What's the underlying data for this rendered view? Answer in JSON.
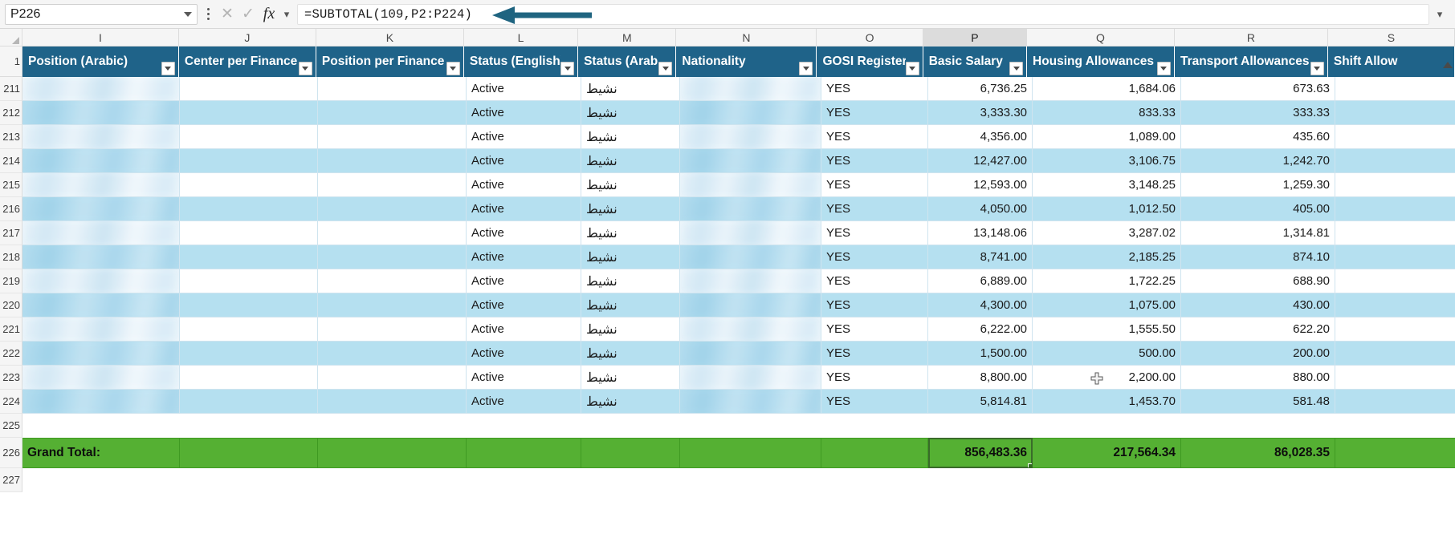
{
  "formula_bar": {
    "name_box_value": "P226",
    "formula": "=SUBTOTAL(109,P2:P224)",
    "cancel_icon": "close-icon",
    "confirm_icon": "check-icon",
    "fx_icon": "fx-icon",
    "arrow_color": "#1f6480"
  },
  "grid": {
    "column_letters": [
      "I",
      "J",
      "K",
      "L",
      "M",
      "N",
      "O",
      "P",
      "Q",
      "R",
      "S"
    ],
    "selected_column": "P",
    "headers": [
      "Position (Arabic)",
      "Center per Finance",
      "Position per Finance",
      "Status (English)",
      "Status (Arabic)",
      "Nationality",
      "GOSI Register",
      "Basic Salary",
      "Housing Allowances",
      "Transport Allowances",
      "Shift Allow"
    ],
    "header_row_number": "1",
    "row_numbers": [
      "211",
      "212",
      "213",
      "214",
      "215",
      "216",
      "217",
      "218",
      "219",
      "220",
      "221",
      "222",
      "223",
      "224",
      "225",
      "226",
      "227"
    ],
    "rows": [
      {
        "num": "211",
        "position_arabic": "",
        "center": "",
        "position_finance": "",
        "status_en": "Active",
        "status_ar": "نشيط",
        "nationality": "",
        "gosi": "YES",
        "basic": "6,736.25",
        "housing": "1,684.06",
        "transport": "673.63",
        "shift": ""
      },
      {
        "num": "212",
        "position_arabic": "",
        "center": "",
        "position_finance": "",
        "status_en": "Active",
        "status_ar": "نشيط",
        "nationality": "",
        "gosi": "YES",
        "basic": "3,333.30",
        "housing": "833.33",
        "transport": "333.33",
        "shift": ""
      },
      {
        "num": "213",
        "position_arabic": "",
        "center": "",
        "position_finance": "",
        "status_en": "Active",
        "status_ar": "نشيط",
        "nationality": "",
        "gosi": "YES",
        "basic": "4,356.00",
        "housing": "1,089.00",
        "transport": "435.60",
        "shift": ""
      },
      {
        "num": "214",
        "position_arabic": "",
        "center": "",
        "position_finance": "",
        "status_en": "Active",
        "status_ar": "نشيط",
        "nationality": "",
        "gosi": "YES",
        "basic": "12,427.00",
        "housing": "3,106.75",
        "transport": "1,242.70",
        "shift": ""
      },
      {
        "num": "215",
        "position_arabic": "",
        "center": "",
        "position_finance": "",
        "status_en": "Active",
        "status_ar": "نشيط",
        "nationality": "",
        "gosi": "YES",
        "basic": "12,593.00",
        "housing": "3,148.25",
        "transport": "1,259.30",
        "shift": ""
      },
      {
        "num": "216",
        "position_arabic": "",
        "center": "",
        "position_finance": "",
        "status_en": "Active",
        "status_ar": "نشيط",
        "nationality": "",
        "gosi": "YES",
        "basic": "4,050.00",
        "housing": "1,012.50",
        "transport": "405.00",
        "shift": ""
      },
      {
        "num": "217",
        "position_arabic": "",
        "center": "",
        "position_finance": "",
        "status_en": "Active",
        "status_ar": "نشيط",
        "nationality": "",
        "gosi": "YES",
        "basic": "13,148.06",
        "housing": "3,287.02",
        "transport": "1,314.81",
        "shift": ""
      },
      {
        "num": "218",
        "position_arabic": "",
        "center": "",
        "position_finance": "",
        "status_en": "Active",
        "status_ar": "نشيط",
        "nationality": "",
        "gosi": "YES",
        "basic": "8,741.00",
        "housing": "2,185.25",
        "transport": "874.10",
        "shift": ""
      },
      {
        "num": "219",
        "position_arabic": "",
        "center": "",
        "position_finance": "",
        "status_en": "Active",
        "status_ar": "نشيط",
        "nationality": "",
        "gosi": "YES",
        "basic": "6,889.00",
        "housing": "1,722.25",
        "transport": "688.90",
        "shift": ""
      },
      {
        "num": "220",
        "position_arabic": "",
        "center": "",
        "position_finance": "",
        "status_en": "Active",
        "status_ar": "نشيط",
        "nationality": "",
        "gosi": "YES",
        "basic": "4,300.00",
        "housing": "1,075.00",
        "transport": "430.00",
        "shift": ""
      },
      {
        "num": "221",
        "position_arabic": "",
        "center": "",
        "position_finance": "",
        "status_en": "Active",
        "status_ar": "نشيط",
        "nationality": "",
        "gosi": "YES",
        "basic": "6,222.00",
        "housing": "1,555.50",
        "transport": "622.20",
        "shift": ""
      },
      {
        "num": "222",
        "position_arabic": "",
        "center": "",
        "position_finance": "",
        "status_en": "Active",
        "status_ar": "نشيط",
        "nationality": "",
        "gosi": "YES",
        "basic": "1,500.00",
        "housing": "500.00",
        "transport": "200.00",
        "shift": ""
      },
      {
        "num": "223",
        "position_arabic": "",
        "center": "",
        "position_finance": "",
        "status_en": "Active",
        "status_ar": "نشيط",
        "nationality": "",
        "gosi": "YES",
        "basic": "8,800.00",
        "housing": "2,200.00",
        "transport": "880.00",
        "shift": ""
      },
      {
        "num": "224",
        "position_arabic": "",
        "center": "",
        "position_finance": "",
        "status_en": "Active",
        "status_ar": "نشيط",
        "nationality": "",
        "gosi": "YES",
        "basic": "5,814.81",
        "housing": "1,453.70",
        "transport": "581.48",
        "shift": ""
      }
    ],
    "blank_row_number": "225",
    "total_row": {
      "num": "226",
      "label": "Grand Total:",
      "basic_total": "856,483.36",
      "housing_total": "217,564.34",
      "transport_total": "86,028.35",
      "shift_total": "",
      "fill_color": "#55b033"
    },
    "trailing_row_number": "227"
  },
  "annotations": {
    "formula_arrow": "left-arrow-annotation",
    "total_arrow": "right-arrow-annotation",
    "cursor": "cell-cursor"
  }
}
